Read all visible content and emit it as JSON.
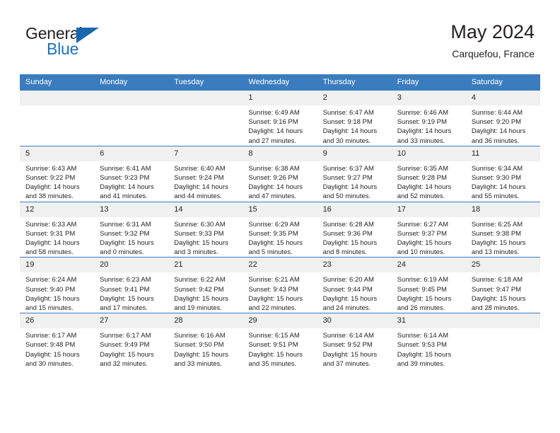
{
  "brand": {
    "name_part1": "General",
    "name_part2": "Blue",
    "triangle_color": "#1b67ad",
    "blue_color": "#1d72b8"
  },
  "header": {
    "title": "May 2024",
    "subtitle": "Carquefou, France"
  },
  "theme": {
    "header_row_bg": "#3a7cbe",
    "daynum_bg": "#f0f0f0",
    "row_divider": "#3a7cbe",
    "text": "#231f20"
  },
  "weekday_headers": [
    "Sunday",
    "Monday",
    "Tuesday",
    "Wednesday",
    "Thursday",
    "Friday",
    "Saturday"
  ],
  "labels": {
    "sunrise_prefix": "Sunrise:",
    "sunset_prefix": "Sunset:",
    "daylight_prefix": "Daylight:"
  },
  "weeks": [
    [
      {
        "day": "",
        "empty": true
      },
      {
        "day": "",
        "empty": true
      },
      {
        "day": "",
        "empty": true
      },
      {
        "day": "1",
        "sunrise": "Sunrise: 6:49 AM",
        "sunset": "Sunset: 9:16 PM",
        "daylight_line1": "Daylight: 14 hours",
        "daylight_line2": "and 27 minutes."
      },
      {
        "day": "2",
        "sunrise": "Sunrise: 6:47 AM",
        "sunset": "Sunset: 9:18 PM",
        "daylight_line1": "Daylight: 14 hours",
        "daylight_line2": "and 30 minutes."
      },
      {
        "day": "3",
        "sunrise": "Sunrise: 6:46 AM",
        "sunset": "Sunset: 9:19 PM",
        "daylight_line1": "Daylight: 14 hours",
        "daylight_line2": "and 33 minutes."
      },
      {
        "day": "4",
        "sunrise": "Sunrise: 6:44 AM",
        "sunset": "Sunset: 9:20 PM",
        "daylight_line1": "Daylight: 14 hours",
        "daylight_line2": "and 36 minutes."
      }
    ],
    [
      {
        "day": "5",
        "sunrise": "Sunrise: 6:43 AM",
        "sunset": "Sunset: 9:22 PM",
        "daylight_line1": "Daylight: 14 hours",
        "daylight_line2": "and 38 minutes."
      },
      {
        "day": "6",
        "sunrise": "Sunrise: 6:41 AM",
        "sunset": "Sunset: 9:23 PM",
        "daylight_line1": "Daylight: 14 hours",
        "daylight_line2": "and 41 minutes."
      },
      {
        "day": "7",
        "sunrise": "Sunrise: 6:40 AM",
        "sunset": "Sunset: 9:24 PM",
        "daylight_line1": "Daylight: 14 hours",
        "daylight_line2": "and 44 minutes."
      },
      {
        "day": "8",
        "sunrise": "Sunrise: 6:38 AM",
        "sunset": "Sunset: 9:26 PM",
        "daylight_line1": "Daylight: 14 hours",
        "daylight_line2": "and 47 minutes."
      },
      {
        "day": "9",
        "sunrise": "Sunrise: 6:37 AM",
        "sunset": "Sunset: 9:27 PM",
        "daylight_line1": "Daylight: 14 hours",
        "daylight_line2": "and 50 minutes."
      },
      {
        "day": "10",
        "sunrise": "Sunrise: 6:35 AM",
        "sunset": "Sunset: 9:28 PM",
        "daylight_line1": "Daylight: 14 hours",
        "daylight_line2": "and 52 minutes."
      },
      {
        "day": "11",
        "sunrise": "Sunrise: 6:34 AM",
        "sunset": "Sunset: 9:30 PM",
        "daylight_line1": "Daylight: 14 hours",
        "daylight_line2": "and 55 minutes."
      }
    ],
    [
      {
        "day": "12",
        "sunrise": "Sunrise: 6:33 AM",
        "sunset": "Sunset: 9:31 PM",
        "daylight_line1": "Daylight: 14 hours",
        "daylight_line2": "and 58 minutes."
      },
      {
        "day": "13",
        "sunrise": "Sunrise: 6:31 AM",
        "sunset": "Sunset: 9:32 PM",
        "daylight_line1": "Daylight: 15 hours",
        "daylight_line2": "and 0 minutes."
      },
      {
        "day": "14",
        "sunrise": "Sunrise: 6:30 AM",
        "sunset": "Sunset: 9:33 PM",
        "daylight_line1": "Daylight: 15 hours",
        "daylight_line2": "and 3 minutes."
      },
      {
        "day": "15",
        "sunrise": "Sunrise: 6:29 AM",
        "sunset": "Sunset: 9:35 PM",
        "daylight_line1": "Daylight: 15 hours",
        "daylight_line2": "and 5 minutes."
      },
      {
        "day": "16",
        "sunrise": "Sunrise: 6:28 AM",
        "sunset": "Sunset: 9:36 PM",
        "daylight_line1": "Daylight: 15 hours",
        "daylight_line2": "and 8 minutes."
      },
      {
        "day": "17",
        "sunrise": "Sunrise: 6:27 AM",
        "sunset": "Sunset: 9:37 PM",
        "daylight_line1": "Daylight: 15 hours",
        "daylight_line2": "and 10 minutes."
      },
      {
        "day": "18",
        "sunrise": "Sunrise: 6:25 AM",
        "sunset": "Sunset: 9:38 PM",
        "daylight_line1": "Daylight: 15 hours",
        "daylight_line2": "and 13 minutes."
      }
    ],
    [
      {
        "day": "19",
        "sunrise": "Sunrise: 6:24 AM",
        "sunset": "Sunset: 9:40 PM",
        "daylight_line1": "Daylight: 15 hours",
        "daylight_line2": "and 15 minutes."
      },
      {
        "day": "20",
        "sunrise": "Sunrise: 6:23 AM",
        "sunset": "Sunset: 9:41 PM",
        "daylight_line1": "Daylight: 15 hours",
        "daylight_line2": "and 17 minutes."
      },
      {
        "day": "21",
        "sunrise": "Sunrise: 6:22 AM",
        "sunset": "Sunset: 9:42 PM",
        "daylight_line1": "Daylight: 15 hours",
        "daylight_line2": "and 19 minutes."
      },
      {
        "day": "22",
        "sunrise": "Sunrise: 6:21 AM",
        "sunset": "Sunset: 9:43 PM",
        "daylight_line1": "Daylight: 15 hours",
        "daylight_line2": "and 22 minutes."
      },
      {
        "day": "23",
        "sunrise": "Sunrise: 6:20 AM",
        "sunset": "Sunset: 9:44 PM",
        "daylight_line1": "Daylight: 15 hours",
        "daylight_line2": "and 24 minutes."
      },
      {
        "day": "24",
        "sunrise": "Sunrise: 6:19 AM",
        "sunset": "Sunset: 9:45 PM",
        "daylight_line1": "Daylight: 15 hours",
        "daylight_line2": "and 26 minutes."
      },
      {
        "day": "25",
        "sunrise": "Sunrise: 6:18 AM",
        "sunset": "Sunset: 9:47 PM",
        "daylight_line1": "Daylight: 15 hours",
        "daylight_line2": "and 28 minutes."
      }
    ],
    [
      {
        "day": "26",
        "sunrise": "Sunrise: 6:17 AM",
        "sunset": "Sunset: 9:48 PM",
        "daylight_line1": "Daylight: 15 hours",
        "daylight_line2": "and 30 minutes."
      },
      {
        "day": "27",
        "sunrise": "Sunrise: 6:17 AM",
        "sunset": "Sunset: 9:49 PM",
        "daylight_line1": "Daylight: 15 hours",
        "daylight_line2": "and 32 minutes."
      },
      {
        "day": "28",
        "sunrise": "Sunrise: 6:16 AM",
        "sunset": "Sunset: 9:50 PM",
        "daylight_line1": "Daylight: 15 hours",
        "daylight_line2": "and 33 minutes."
      },
      {
        "day": "29",
        "sunrise": "Sunrise: 6:15 AM",
        "sunset": "Sunset: 9:51 PM",
        "daylight_line1": "Daylight: 15 hours",
        "daylight_line2": "and 35 minutes."
      },
      {
        "day": "30",
        "sunrise": "Sunrise: 6:14 AM",
        "sunset": "Sunset: 9:52 PM",
        "daylight_line1": "Daylight: 15 hours",
        "daylight_line2": "and 37 minutes."
      },
      {
        "day": "31",
        "sunrise": "Sunrise: 6:14 AM",
        "sunset": "Sunset: 9:53 PM",
        "daylight_line1": "Daylight: 15 hours",
        "daylight_line2": "and 39 minutes."
      },
      {
        "day": "",
        "empty": true
      }
    ]
  ]
}
